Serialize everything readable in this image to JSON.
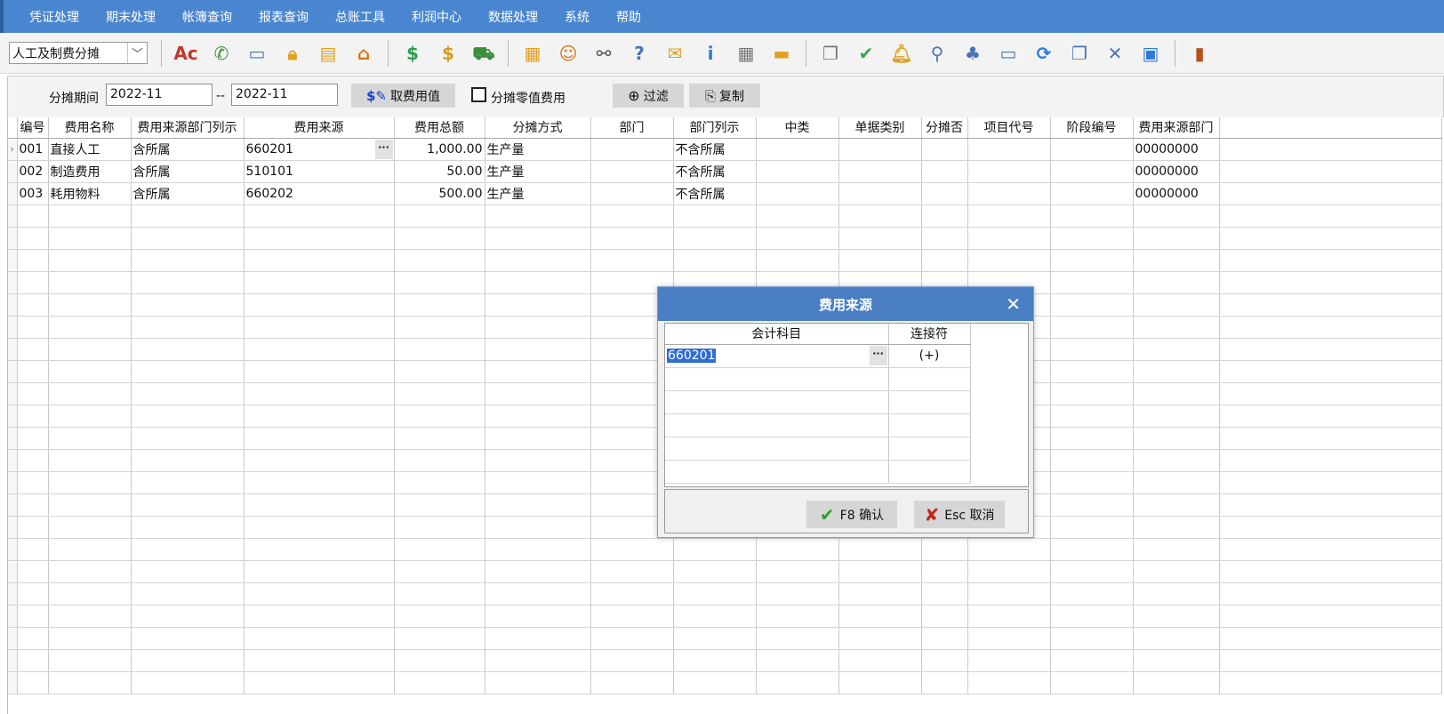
{
  "menu": [
    "凭证处理",
    "期末处理",
    "帐簿查询",
    "报表查询",
    "总账工具",
    "利润中心",
    "数据处理",
    "系统",
    "帮助"
  ],
  "toolbar": {
    "module_select": "人工及制费分摊",
    "icons": [
      {
        "name": "spelling-icon",
        "glyph": "Ac",
        "color": "#c0392b"
      },
      {
        "name": "phone-icon",
        "glyph": "✆",
        "color": "#3a8e3a"
      },
      {
        "name": "screen-icon",
        "glyph": "▭",
        "color": "#4a73b8"
      },
      {
        "name": "lock-icon",
        "glyph": "🔒︎",
        "color": "#e0a020"
      },
      {
        "name": "briefcase-icon",
        "glyph": "▤",
        "color": "#e0a020"
      },
      {
        "name": "home-icon",
        "glyph": "⌂",
        "color": "#d9730d"
      },
      {
        "name": "dollar-coin-icon",
        "glyph": "$",
        "color": "#2e9e4a"
      },
      {
        "name": "money-bag-icon",
        "glyph": "$",
        "color": "#d99a1e"
      },
      {
        "name": "cart-icon",
        "glyph": "⛟",
        "color": "#3a8e3a"
      },
      {
        "name": "clipboard-icon",
        "glyph": "▦",
        "color": "#e0a020"
      },
      {
        "name": "users-icon",
        "glyph": "☺",
        "color": "#d9730d"
      },
      {
        "name": "link-icon",
        "glyph": "⚯",
        "color": "#555555"
      },
      {
        "name": "help-doc-icon",
        "glyph": "?",
        "color": "#4a73b8"
      },
      {
        "name": "mail-icon",
        "glyph": "✉",
        "color": "#e0a020"
      },
      {
        "name": "info-icon",
        "glyph": "i",
        "color": "#2f7ad8"
      },
      {
        "name": "calculator-icon",
        "glyph": "▦",
        "color": "#777777"
      },
      {
        "name": "folder-icon",
        "glyph": "▬",
        "color": "#e0a020"
      },
      {
        "name": "copy-doc-icon",
        "glyph": "❐",
        "color": "#777777"
      },
      {
        "name": "check-circle-icon",
        "glyph": "✔",
        "color": "#3aa84a"
      },
      {
        "name": "bell-icon",
        "glyph": "🔔︎",
        "color": "#e0a020"
      },
      {
        "name": "search-icon",
        "glyph": "⚲",
        "color": "#4a73b8"
      },
      {
        "name": "org-chart-icon",
        "glyph": "♣",
        "color": "#4a73b8"
      },
      {
        "name": "monitor-icon",
        "glyph": "▭",
        "color": "#4a73b8"
      },
      {
        "name": "refresh-icon",
        "glyph": "⟳",
        "color": "#2f7ad8"
      },
      {
        "name": "restore-window-icon",
        "glyph": "❐",
        "color": "#4a73b8"
      },
      {
        "name": "close-window-icon",
        "glyph": "✕",
        "color": "#4a73b8"
      },
      {
        "name": "window-icon",
        "glyph": "▣",
        "color": "#2f7ad8"
      },
      {
        "name": "exit-door-icon",
        "glyph": "▮",
        "color": "#b5501e"
      }
    ]
  },
  "filter": {
    "period_label": "分摊期间",
    "period_from": "2022-11",
    "dash": "--",
    "period_to": "2022-11",
    "fetch_label": "取费用值",
    "zero_label": "分摊零值费用",
    "filter_label": "过滤",
    "copy_label": "复制"
  },
  "grid": {
    "columns": [
      "编号",
      "费用名称",
      "费用来源部门列示",
      "费用来源",
      "费用总额",
      "分摊方式",
      "部门",
      "部门列示",
      "中类",
      "单据类别",
      "分摊否",
      "项目代号",
      "阶段编号",
      "费用来源部门"
    ],
    "rows": [
      {
        "code": "001",
        "name": "直接人工",
        "src_dept_show": "含所属",
        "source": "660201",
        "total": "1,000.00",
        "method": "生产量",
        "dept": "",
        "dept_show": "不含所属",
        "category": "",
        "doc_type": "",
        "alloc": "",
        "project": "",
        "stage": "",
        "src_dept": "00000000"
      },
      {
        "code": "002",
        "name": "制造费用",
        "src_dept_show": "含所属",
        "source": "510101",
        "total": "50.00",
        "method": "生产量",
        "dept": "",
        "dept_show": "不含所属",
        "category": "",
        "doc_type": "",
        "alloc": "",
        "project": "",
        "stage": "",
        "src_dept": "00000000"
      },
      {
        "code": "003",
        "name": "耗用物料",
        "src_dept_show": "含所属",
        "source": "660202",
        "total": "500.00",
        "method": "生产量",
        "dept": "",
        "dept_show": "不含所属",
        "category": "",
        "doc_type": "",
        "alloc": "",
        "project": "",
        "stage": "",
        "src_dept": "00000000"
      }
    ]
  },
  "dialog": {
    "title": "费用来源",
    "close": "✕",
    "columns": [
      "会计科目",
      "连接符"
    ],
    "rows": [
      {
        "account": "660201",
        "connector": "(+)"
      }
    ],
    "confirm_label": "F8 确认",
    "cancel_label": "Esc 取消"
  }
}
